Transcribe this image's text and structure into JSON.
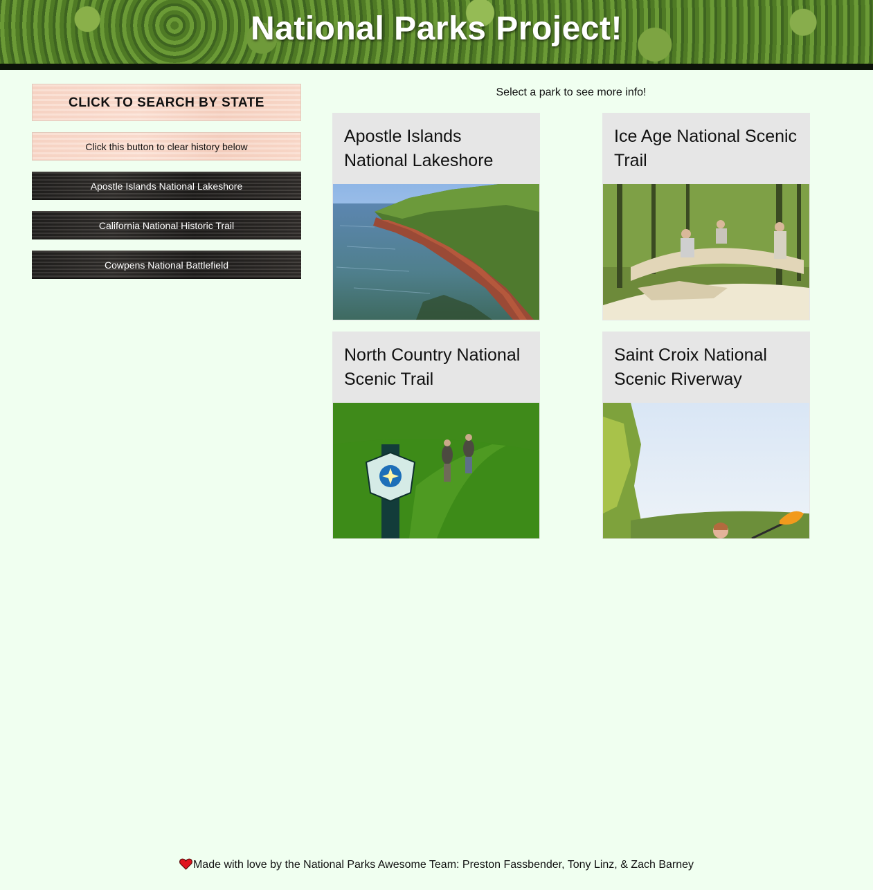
{
  "header": {
    "title": "National Parks Project!"
  },
  "sidebar": {
    "search_button": "CLICK TO SEARCH BY STATE",
    "clear_button": "Click this button to clear history below",
    "history": [
      "Apostle Islands National Lakeshore",
      "California National Historic Trail",
      "Cowpens National Battlefield"
    ]
  },
  "main": {
    "prompt": "Select a park to see more info!",
    "parks": [
      {
        "name": "Apostle Islands National Lakeshore",
        "image": "lakeshore-cliffs-photo"
      },
      {
        "name": "Ice Age National Scenic Trail",
        "image": "boardwalk-construction-photo"
      },
      {
        "name": "North Country National Scenic Trail",
        "image": "hikers-trail-sign-photo"
      },
      {
        "name": "Saint Croix National Scenic Riverway",
        "image": "kayaker-river-photo"
      }
    ]
  },
  "footer": {
    "icon": "heart-icon",
    "text": "Made with love by the National Parks Awesome Team: Preston Fassbender, Tony Linz, & Zach Barney"
  },
  "colors": {
    "page_background": "#f0fff0",
    "card_background": "#e6e6e6",
    "header_bar": "#0c1209"
  }
}
